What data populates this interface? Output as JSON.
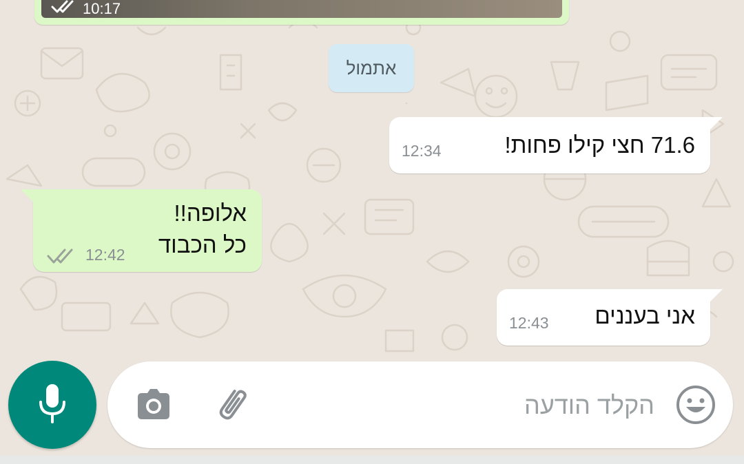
{
  "chat": {
    "previous_message": {
      "time": "10:17",
      "status_icon": "double-check-icon"
    },
    "date_separator": "אתמול",
    "messages": [
      {
        "direction": "incoming",
        "text": "71.6  חצי קילו פחות!",
        "time": "12:34"
      },
      {
        "direction": "outgoing",
        "lines": [
          "אלופה!!",
          "כל הכבוד"
        ],
        "time": "12:42",
        "status_icon": "double-check-icon"
      },
      {
        "direction": "incoming",
        "text": "אני בעננים",
        "time": "12:43"
      }
    ]
  },
  "composer": {
    "placeholder": "הקלד הודעה",
    "emoji_icon": "smiley-icon",
    "attach_icon": "paperclip-icon",
    "camera_icon": "camera-icon",
    "mic_icon": "microphone-icon"
  },
  "colors": {
    "wallpaper": "#ECE5DD",
    "incoming_bubble": "#FFFFFF",
    "outgoing_bubble": "#DCF8C6",
    "date_chip": "#D4EAF4",
    "accent": "#00897B",
    "read_tick": "#9aa39a"
  }
}
